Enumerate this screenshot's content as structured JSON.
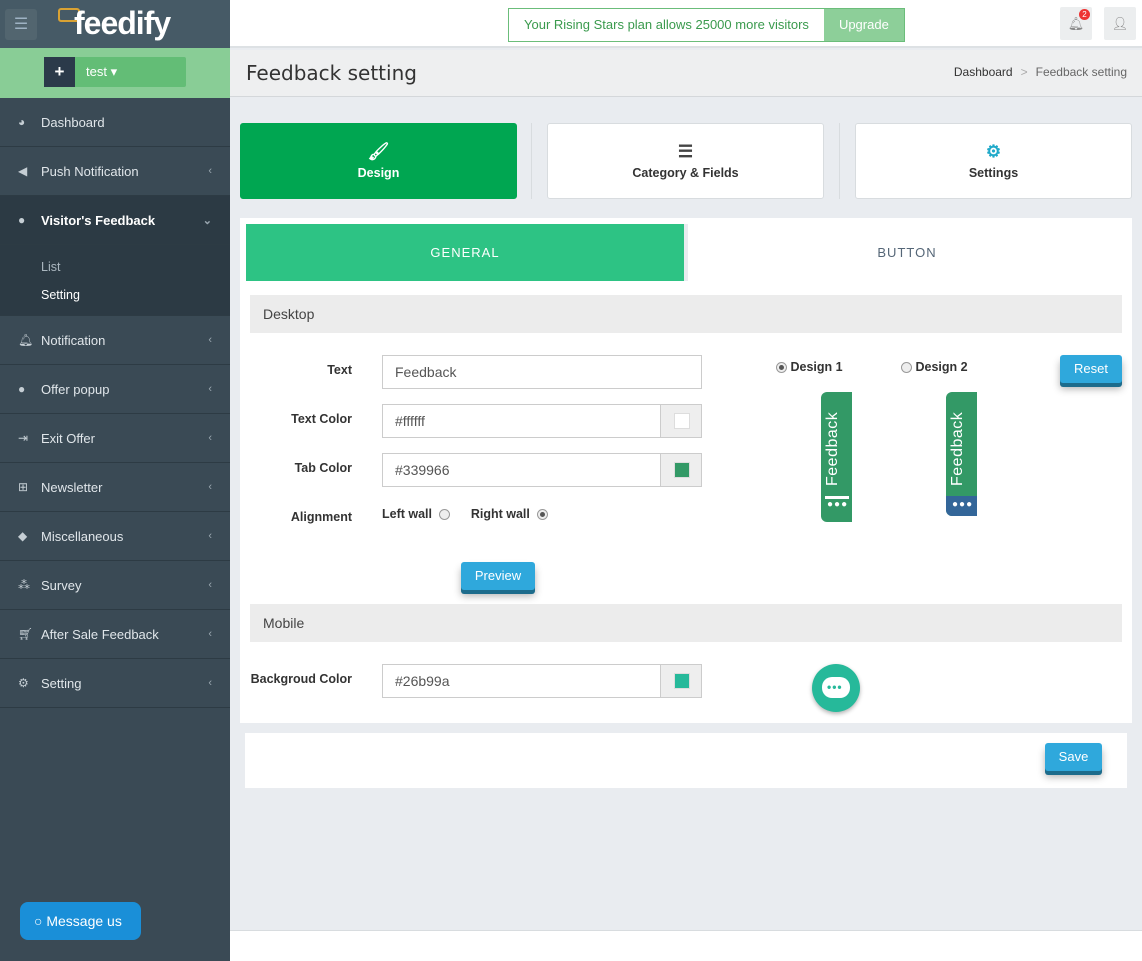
{
  "app": {
    "logo": "feedify",
    "project": "test"
  },
  "sidebar": {
    "items": [
      {
        "label": "Dashboard",
        "icon": "dashboard-icon"
      },
      {
        "label": "Push Notification",
        "icon": "bullhorn-icon"
      },
      {
        "label": "Visitor's Feedback",
        "icon": "users-icon"
      },
      {
        "label": "Notification",
        "icon": "bell-icon"
      },
      {
        "label": "Offer popup",
        "icon": "comment-icon"
      },
      {
        "label": "Exit Offer",
        "icon": "sign-out-icon"
      },
      {
        "label": "Newsletter",
        "icon": "plus-square-icon"
      },
      {
        "label": "Miscellaneous",
        "icon": "tag-icon"
      },
      {
        "label": "Survey",
        "icon": "cubes-icon"
      },
      {
        "label": "After Sale Feedback",
        "icon": "cart-icon"
      },
      {
        "label": "Setting",
        "icon": "gear-icon"
      }
    ],
    "sub": [
      "List",
      "Setting"
    ],
    "message": "Message us"
  },
  "topbar": {
    "plan": "Your Rising Stars plan allows 25000 more visitors",
    "upgrade": "Upgrade",
    "notifications": "2"
  },
  "header": {
    "title": "Feedback setting",
    "breadcrumb": [
      "Dashboard",
      "Feedback setting"
    ]
  },
  "tabs": [
    "Design",
    "Category & Fields",
    "Settings"
  ],
  "subtabs": [
    "GENERAL",
    "BUTTON"
  ],
  "desktop": {
    "section": "Desktop",
    "text_label": "Text",
    "text": "Feedback",
    "text_color_label": "Text Color",
    "text_color": "#ffffff",
    "tab_color_label": "Tab Color",
    "tab_color": "#339966",
    "alignment_label": "Alignment",
    "left": "Left wall",
    "right": "Right wall",
    "design1": "Design 1",
    "design2": "Design 2",
    "reset": "Reset",
    "preview": "Preview",
    "tab_text": "Feedback",
    "design2_color": "#336699"
  },
  "mobile": {
    "section": "Mobile",
    "bg_label": "Backgroud Color",
    "bg": "#26b99a"
  },
  "save": "Save"
}
